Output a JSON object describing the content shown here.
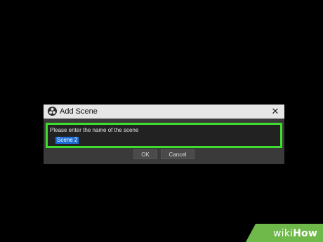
{
  "dialog": {
    "title": "Add Scene",
    "close_glyph": "✕",
    "prompt": "Please enter the name of the scene",
    "name_value": "Scene 2",
    "ok_label": "OK",
    "cancel_label": "Cancel"
  },
  "watermark": {
    "wiki": "wiki",
    "how": "How"
  },
  "colors": {
    "background": "#000000",
    "titlebar": "#e6e6e6",
    "dialog_body": "#3a3a3a",
    "highlight_border": "#3ddc2f",
    "selection": "#1b6fd8",
    "watermark": "#6fb84a"
  },
  "icons": {
    "app": "obs-logo-icon",
    "close": "close-icon"
  }
}
